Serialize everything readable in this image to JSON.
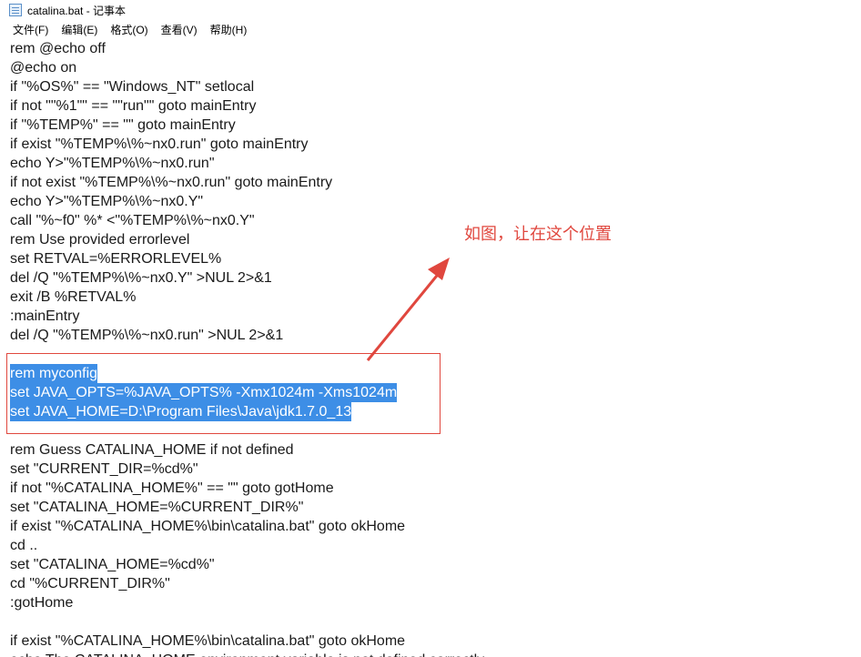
{
  "window": {
    "title": "catalina.bat - 记事本"
  },
  "menu": [
    "文件(F)",
    "编辑(E)",
    "格式(O)",
    "查看(V)",
    "帮助(H)"
  ],
  "lines": [
    "rem @echo off",
    "@echo on",
    "if \"%OS%\" == \"Windows_NT\" setlocal",
    "if not \"\"%1\"\" == \"\"run\"\" goto mainEntry",
    "if \"%TEMP%\" == \"\" goto mainEntry",
    "if exist \"%TEMP%\\%~nx0.run\" goto mainEntry",
    "echo Y>\"%TEMP%\\%~nx0.run\"",
    "if not exist \"%TEMP%\\%~nx0.run\" goto mainEntry",
    "echo Y>\"%TEMP%\\%~nx0.Y\"",
    "call \"%~f0\" %* <\"%TEMP%\\%~nx0.Y\"",
    "rem Use provided errorlevel",
    "set RETVAL=%ERRORLEVEL%",
    "del /Q \"%TEMP%\\%~nx0.Y\" >NUL 2>&1",
    "exit /B %RETVAL%",
    ":mainEntry",
    "del /Q \"%TEMP%\\%~nx0.run\" >NUL 2>&1",
    "",
    "rem myconfig",
    "set JAVA_OPTS=%JAVA_OPTS% -Xmx1024m -Xms1024m",
    "set JAVA_HOME=D:\\Program Files\\Java\\jdk1.7.0_13",
    "",
    "rem Guess CATALINA_HOME if not defined",
    "set \"CURRENT_DIR=%cd%\"",
    "if not \"%CATALINA_HOME%\" == \"\" goto gotHome",
    "set \"CATALINA_HOME=%CURRENT_DIR%\"",
    "if exist \"%CATALINA_HOME%\\bin\\catalina.bat\" goto okHome",
    "cd ..",
    "set \"CATALINA_HOME=%cd%\"",
    "cd \"%CURRENT_DIR%\"",
    ":gotHome",
    "",
    "if exist \"%CATALINA_HOME%\\bin\\catalina.bat\" goto okHome",
    "echo The CATALINA_HOME environment variable is not defined correctly"
  ],
  "selected_lines": [
    17,
    18,
    19
  ],
  "annotation": {
    "text": "如图，让在这个位置",
    "color": "#e0473e"
  },
  "colors": {
    "selection": "#3d8ee6",
    "annotation": "#e0473e"
  }
}
